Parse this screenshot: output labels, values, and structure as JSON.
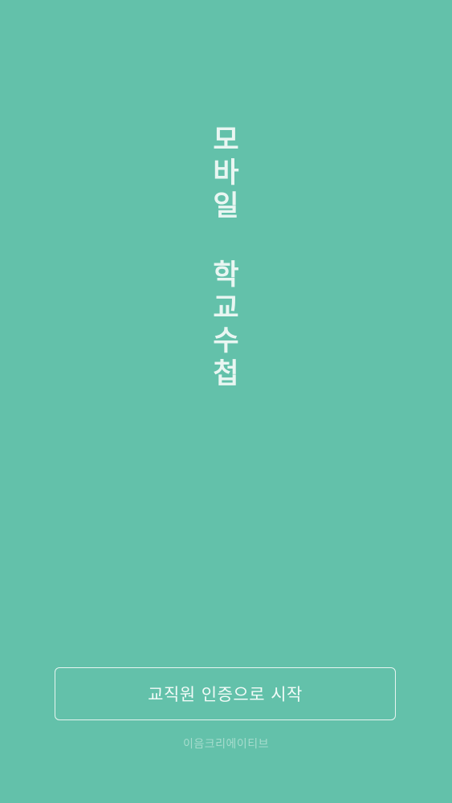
{
  "app": {
    "title_line1": [
      "모",
      "바",
      "일"
    ],
    "title_line2": [
      "학",
      "교",
      "수",
      "첩"
    ]
  },
  "start_button": {
    "label": "교직원 인증으로 시작"
  },
  "footer": {
    "company": "이음크리에이티브"
  },
  "colors": {
    "background": "#63c1aa",
    "text": "#e9f6f2",
    "footer_text": "#a6dccd"
  }
}
